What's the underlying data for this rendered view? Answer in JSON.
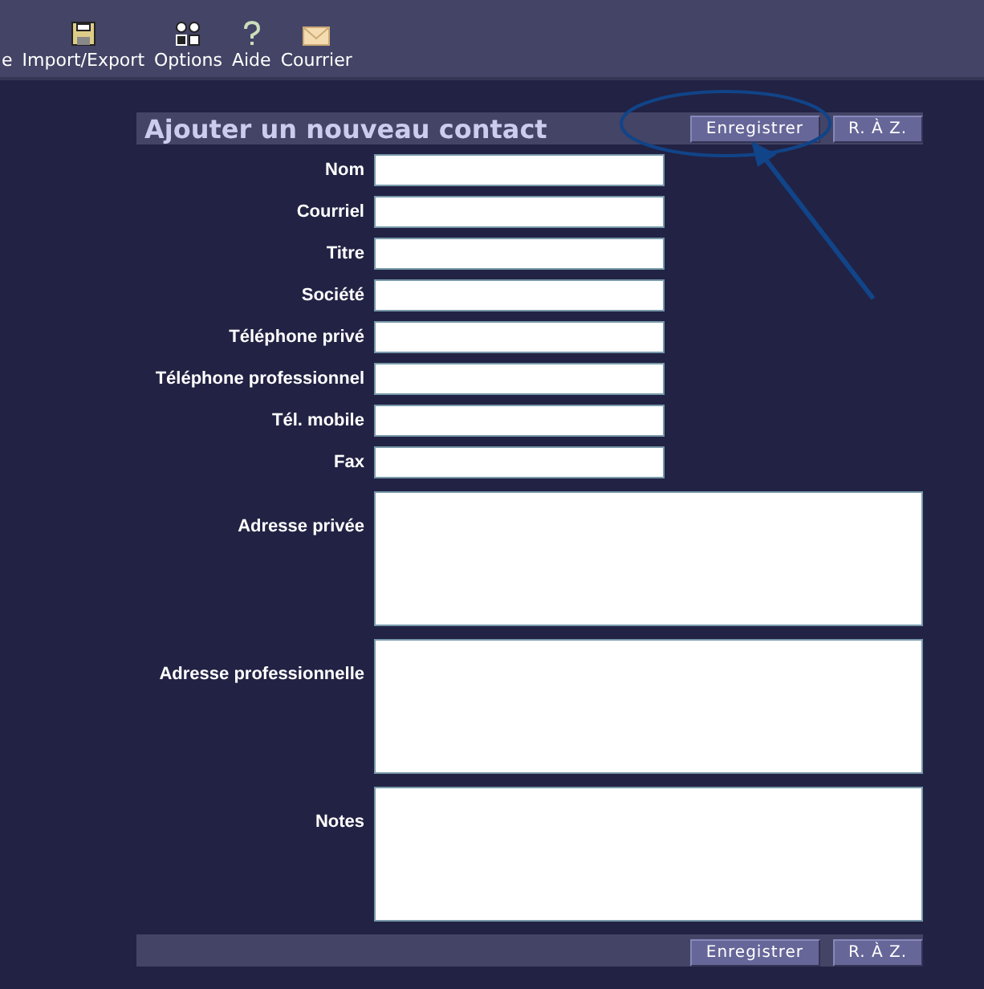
{
  "toolbar": [
    {
      "label": "e",
      "kind": "none"
    },
    {
      "label": "Import/Export",
      "kind": "disk"
    },
    {
      "label": "Options",
      "kind": "options"
    },
    {
      "label": "Aide",
      "kind": "help"
    },
    {
      "label": "Courrier",
      "kind": "mail"
    }
  ],
  "form": {
    "title": "Ajouter un nouveau contact",
    "buttons": [
      "Enregistrer",
      "R. À Z."
    ],
    "fields": [
      {
        "label": "Nom",
        "kind": "line"
      },
      {
        "label": "Courriel",
        "kind": "line"
      },
      {
        "label": "Titre",
        "kind": "line"
      },
      {
        "label": "Société",
        "kind": "line"
      },
      {
        "label": "Téléphone privé",
        "kind": "line"
      },
      {
        "label": "Téléphone professionnel",
        "kind": "line"
      },
      {
        "label": "Tél. mobile",
        "kind": "line"
      },
      {
        "label": "Fax",
        "kind": "line"
      },
      {
        "label": "Adresse privée",
        "kind": "area"
      },
      {
        "label": "Adresse professionnelle",
        "kind": "area"
      },
      {
        "label": "Notes",
        "kind": "area"
      }
    ],
    "footer_buttons": [
      "Enregistrer",
      "R. À Z."
    ]
  }
}
